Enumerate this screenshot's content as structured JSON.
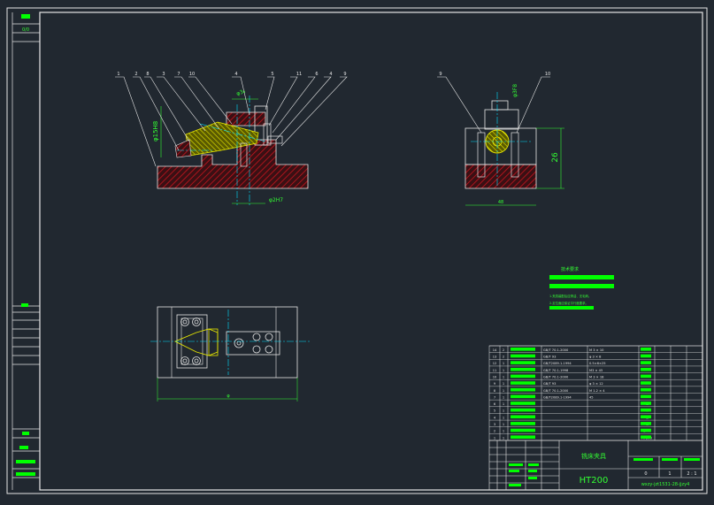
{
  "colors": {
    "background": "#212830",
    "frame": "#e6e6e6",
    "green_fill": "#00ff00",
    "green_text": "#33ff33",
    "red_hatch": "#b0101a",
    "yellow": "#e8e800",
    "cyan": "#00e0ff",
    "white": "#ffffff",
    "leader": "#e6e6e6"
  },
  "left_strip": {
    "top_label": "0/0"
  },
  "front_view": {
    "callouts": [
      "1",
      "2",
      "8",
      "3",
      "7",
      "10",
      "4",
      "5",
      "11",
      "6",
      "4",
      "9"
    ],
    "dim_top": "φ3₀",
    "dim_left": "φ15H8",
    "dim_bottom": "φ2H7"
  },
  "side_view": {
    "callouts": [
      "9",
      "10"
    ],
    "dim_top": "φ3F8",
    "dim_height": "26",
    "dim_width": "48"
  },
  "top_view": {
    "dim_width": "φ"
  },
  "tech_req": {
    "title": "技术要求",
    "line1": "1.夹具装配后应清洁、无毛刺。",
    "line2": "2.定位面应保证平行度要求。"
  },
  "bom": {
    "rows": [
      {
        "no": "14",
        "qty": "2",
        "std": "GB/T 70.1-2000",
        "spec": "M 3 × 10",
        "mat": ""
      },
      {
        "no": "13",
        "qty": "2",
        "std": "GB/T 93",
        "spec": "φ 3 × 8",
        "mat": ""
      },
      {
        "no": "12",
        "qty": "1",
        "std": "GB/T2089.1-1994",
        "spec": "0.5×6×25",
        "mat": ""
      },
      {
        "no": "11",
        "qty": "1",
        "std": "GB/T 70.1-1998",
        "spec": "M3 × 45",
        "mat": ""
      },
      {
        "no": "10",
        "qty": "1",
        "std": "GB/T 70.1-2000",
        "spec": "M 3 × 18",
        "mat": ""
      },
      {
        "no": "9",
        "qty": "1",
        "std": "GB/T 93",
        "spec": "φ 3 × 12",
        "mat": ""
      },
      {
        "no": "8",
        "qty": "1",
        "std": "GB/T 70.1-2000",
        "spec": "M 1.2 × 4",
        "mat": ""
      },
      {
        "no": "7",
        "qty": "1",
        "std": "GB/T2089.1-1994",
        "spec": "45",
        "mat": ""
      },
      {
        "no": "6",
        "qty": "1",
        "std": "",
        "spec": "",
        "mat": "45"
      },
      {
        "no": "5",
        "qty": "1",
        "std": "",
        "spec": "",
        "mat": "45"
      },
      {
        "no": "4",
        "qty": "1",
        "std": "",
        "spec": "",
        "mat": "45"
      },
      {
        "no": "3",
        "qty": "1",
        "std": "",
        "spec": "",
        "mat": "45"
      },
      {
        "no": "2",
        "qty": "1",
        "std": "",
        "spec": "",
        "mat": "Q235"
      },
      {
        "no": "1",
        "qty": "1",
        "std": "",
        "spec": "",
        "mat": "HT200"
      }
    ]
  },
  "title_block": {
    "drawing_name": "铣床夹具",
    "material": "HT200",
    "file_name": "wxzy-jzt1531-28-jjzy4",
    "scale_values": [
      "0",
      "1",
      "2 : 1"
    ]
  }
}
